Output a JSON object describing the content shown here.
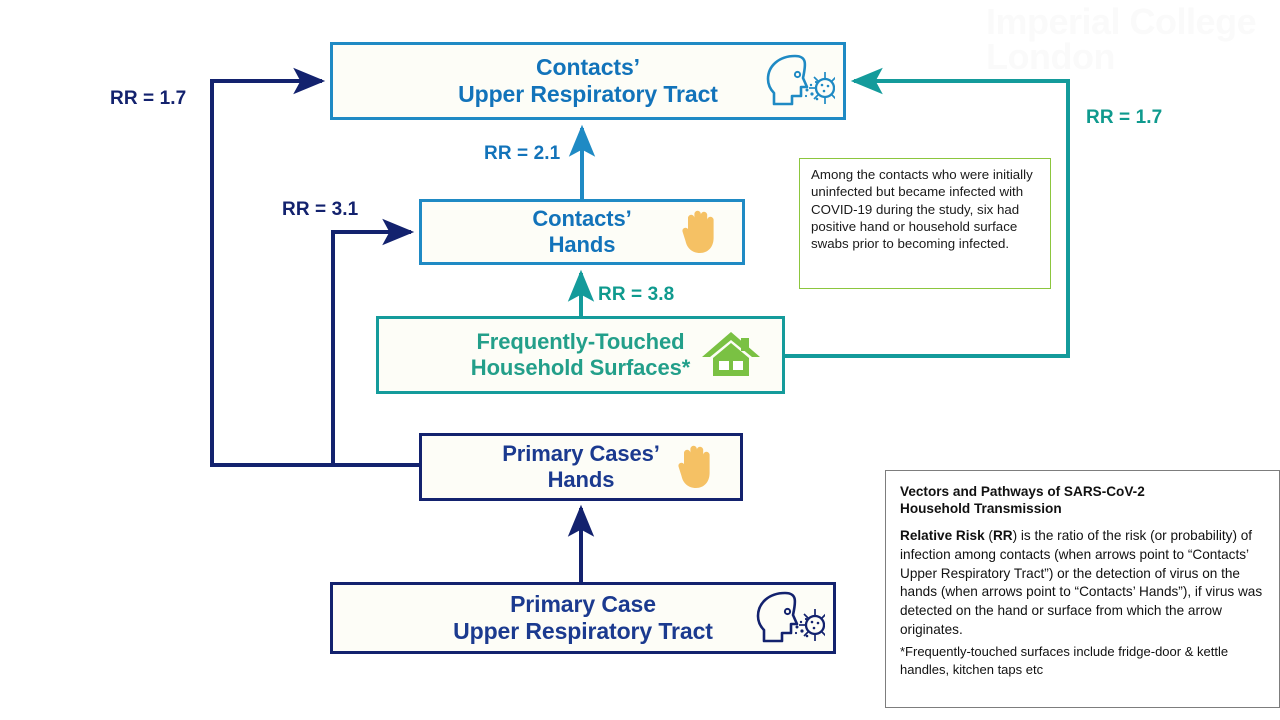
{
  "watermark": {
    "text": "Imperial College\nLondon"
  },
  "nodes": {
    "contacts_urt": {
      "label": "Contacts’\nUpper Respiratory Tract",
      "icon": "head-virus-icon"
    },
    "contacts_hands": {
      "label": "Contacts’\nHands",
      "icon": "raised-hand-icon"
    },
    "surfaces": {
      "label": "Frequently-Touched\nHousehold Surfaces*",
      "icon": "house-icon"
    },
    "primary_hands": {
      "label": "Primary Cases’\nHands",
      "icon": "raised-hand-icon"
    },
    "primary_urt": {
      "label": "Primary Case\nUpper Respiratory Tract",
      "icon": "head-virus-icon"
    }
  },
  "edges": {
    "primary_hands_to_contacts_urt": {
      "label": "RR = 1.7",
      "color": "#13226e"
    },
    "primary_hands_to_contacts_hands": {
      "label": "RR = 3.1",
      "color": "#13226e"
    },
    "contacts_hands_to_contacts_urt": {
      "label": "RR = 2.1",
      "color": "#1273ba"
    },
    "surfaces_to_contacts_hands": {
      "label": "RR = 3.8",
      "color": "#0f9a8e"
    },
    "surfaces_to_contacts_urt": {
      "label": "RR = 1.7",
      "color": "#0f9a8e"
    }
  },
  "annotation": {
    "text": "Among the contacts who were initially uninfected but became infected with COVID-19 during the study, six had positive hand or household surface swabs prior to becoming infected.",
    "border_color": "#8cc63e"
  },
  "legend": {
    "title": "Vectors and Pathways of SARS-CoV-2\nHousehold Transmission",
    "body_lead": "Relative Risk",
    "body_rr": "RR",
    "body_part1": " (",
    "body_part2": ") is the ratio of the risk (or probability) of infection among contacts (when arrows point to “Contacts’ Upper Respiratory Tract”) or the detection of virus on the hands (when arrows point to “Contacts’ Hands”), if virus was detected on the hand or surface from which the arrow originates.",
    "note": "*Frequently-touched surfaces include fridge-door & kettle handles, kitchen taps etc"
  },
  "colors": {
    "navy": "#13226e",
    "blue": "#1f8ac4",
    "blue_text": "#1273ba",
    "teal": "#149b9b",
    "teal_text": "#0f9a8e",
    "green": "#8cc63e",
    "hand": "#f5c164",
    "house": "#7ac143",
    "box_fill": "#fdfdf7"
  }
}
